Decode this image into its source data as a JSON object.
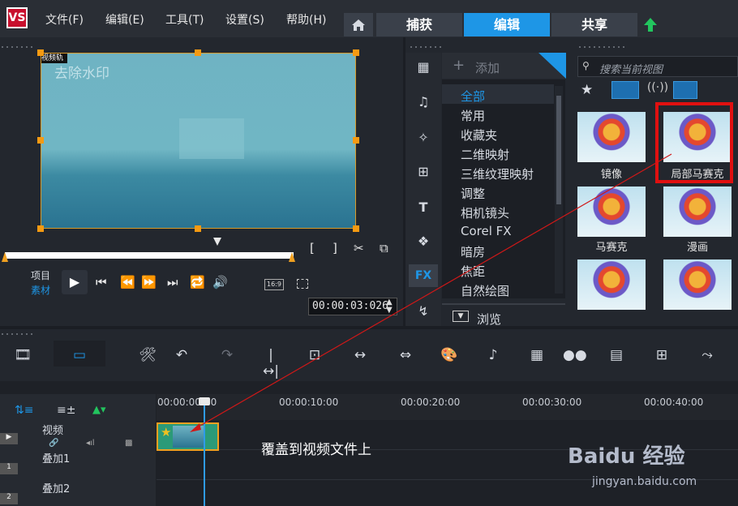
{
  "menu": {
    "logo": "VS",
    "items": [
      "文件(F)",
      "编辑(E)",
      "工具(T)",
      "设置(S)",
      "帮助(H)"
    ],
    "tabs": [
      "捕获",
      "编辑",
      "共享"
    ]
  },
  "preview": {
    "overlay_text": "视频轨",
    "watermark_text": "去除水印",
    "project_label": "项目",
    "clip_label": "素材",
    "timecode": "00:00:03:026",
    "aspect": "16:9"
  },
  "library": {
    "add_label": "添加",
    "categories": [
      "全部",
      "常用",
      "收藏夹",
      "二维映射",
      "三维纹理映射",
      "调整",
      "相机镜头",
      "Corel FX",
      "暗房",
      "焦距",
      "自然绘图"
    ],
    "selected_category": "全部",
    "browse_label": "浏览",
    "search_placeholder": "搜索当前视图",
    "thumbnails": [
      "镜像",
      "局部马赛克",
      "马赛克",
      "漫画",
      "",
      ""
    ],
    "fx_label": "FX"
  },
  "timeline": {
    "ruler": [
      "00:00:00:00",
      "00:00:10:00",
      "00:00:20:00",
      "00:00:30:00",
      "00:00:40:00"
    ],
    "tracks": [
      "视频",
      "叠加1",
      "叠加2"
    ],
    "caption": "覆盖到视频文件上"
  },
  "watermark": {
    "brand": "Baidu 经验",
    "url": "jingyan.baidu.com"
  },
  "colors": {
    "accent": "#1e96e6",
    "highlight": "#e01010",
    "handle": "#f59a12"
  }
}
